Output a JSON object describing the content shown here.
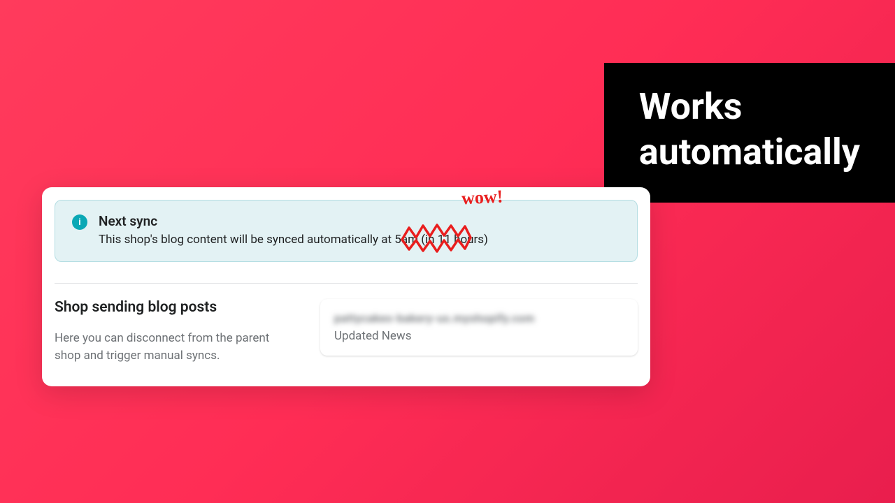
{
  "headline": "Works\nautomatically",
  "banner": {
    "title": "Next sync",
    "text": "This shop's blog content will be synced automatically at 5am (in 11 hours)"
  },
  "section": {
    "title": "Shop sending blog posts",
    "desc": "Here you can disconnect from the parent shop and trigger manual syncs."
  },
  "shop": {
    "url_blurred": "pattycakes-bakery-us.myshopify.com",
    "label": "Updated News"
  },
  "annotation": {
    "wow": "wow!"
  }
}
